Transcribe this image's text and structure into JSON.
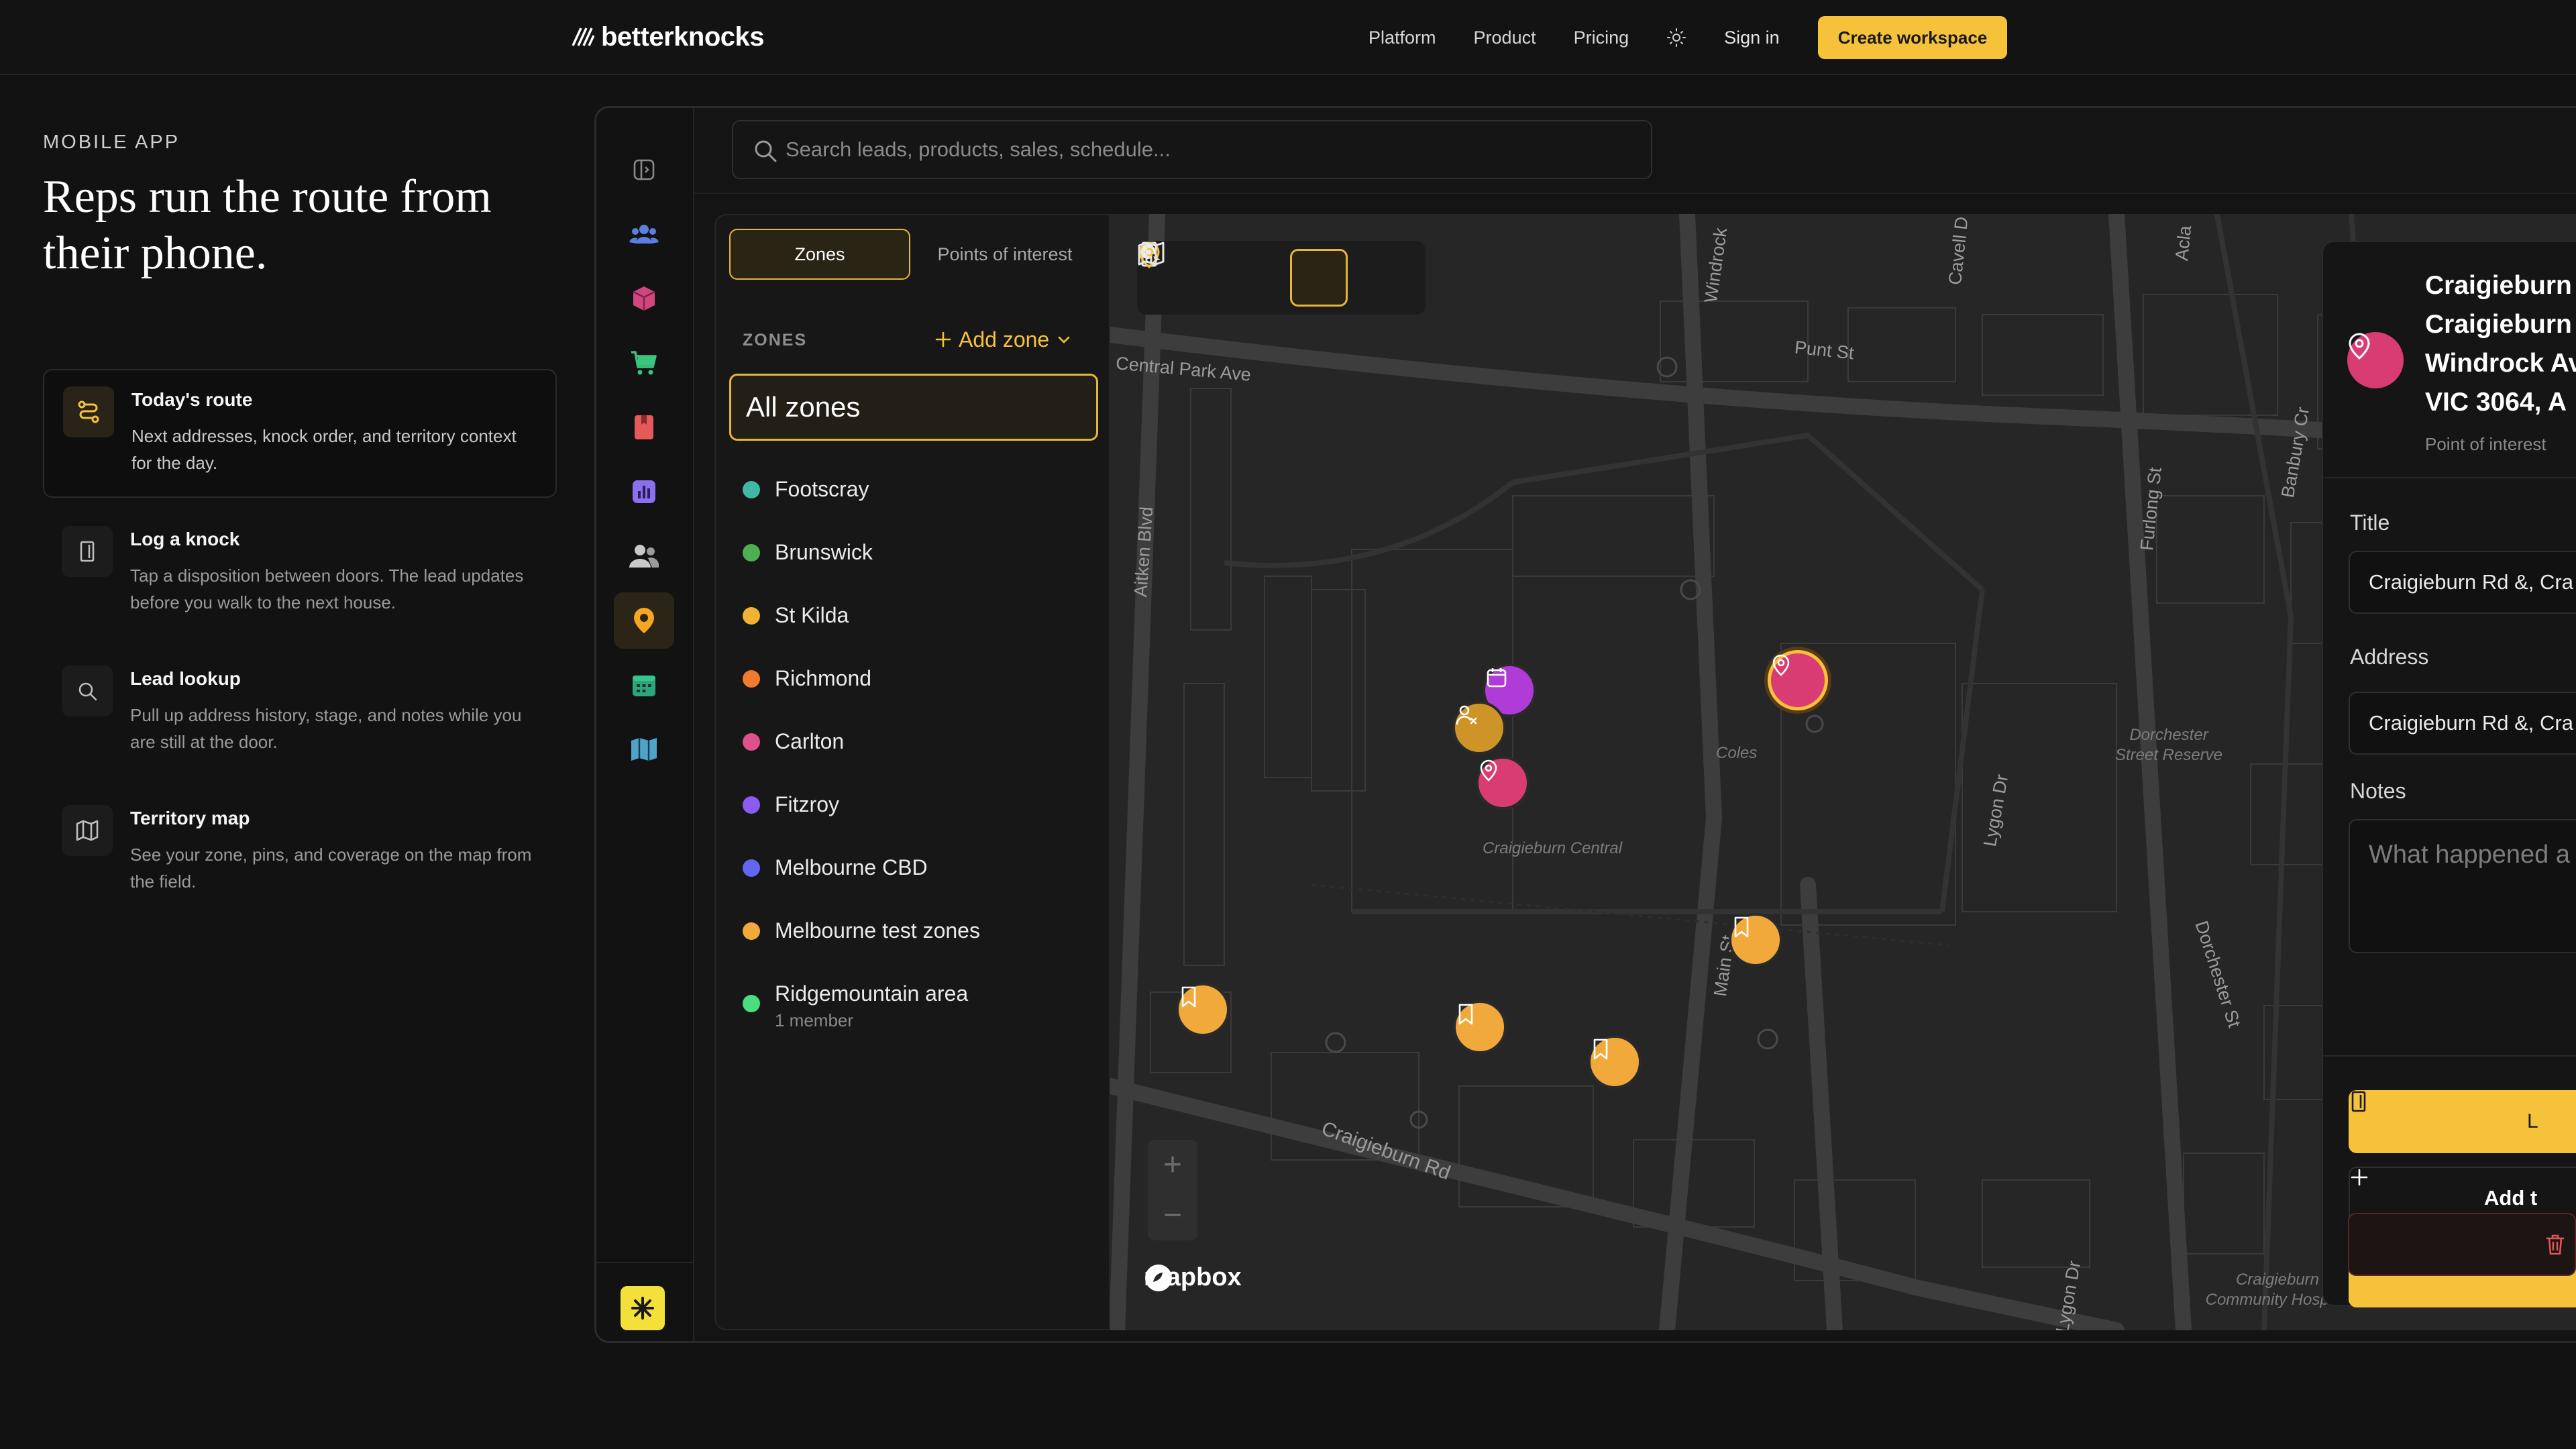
{
  "nav": {
    "brand": "betterknocks",
    "links": [
      "Platform",
      "Product",
      "Pricing"
    ],
    "signin": "Sign in",
    "cta": "Create workspace"
  },
  "hero": {
    "eyebrow": "MOBILE APP",
    "headline": "Reps run the route from their phone."
  },
  "features": [
    {
      "title": "Today's route",
      "desc": "Next addresses, knock order, and territory context for the day.",
      "icon": "route-icon"
    },
    {
      "title": "Log a knock",
      "desc": "Tap a disposition between doors. The lead updates before you walk to the next house.",
      "icon": "door-icon"
    },
    {
      "title": "Lead lookup",
      "desc": "Pull up address history, stage, and notes while you are still at the door.",
      "icon": "search-icon"
    },
    {
      "title": "Territory map",
      "desc": "See your zone, pins, and coverage on the map from the field.",
      "icon": "map-icon"
    }
  ],
  "app": {
    "search_placeholder": "Search leads, products, sales, schedule...",
    "tabs": [
      "Zones",
      "Points of interest"
    ],
    "zones_label": "ZONES",
    "add_zone": "Add zone",
    "all_zones": "All zones",
    "zones": [
      {
        "name": "Footscray",
        "color": "#3fb8a6"
      },
      {
        "name": "Brunswick",
        "color": "#4caf50"
      },
      {
        "name": "St Kilda",
        "color": "#f2b233"
      },
      {
        "name": "Richmond",
        "color": "#f07a2e"
      },
      {
        "name": "Carlton",
        "color": "#e0508a"
      },
      {
        "name": "Fitzroy",
        "color": "#8a5cf0"
      },
      {
        "name": "Melbourne CBD",
        "color": "#6366f1"
      },
      {
        "name": "Melbourne test zones",
        "color": "#f2a93b"
      },
      {
        "name": "Ridgemountain area",
        "color": "#4ade80",
        "sub": "1 member"
      }
    ]
  },
  "map": {
    "streets": [
      "Central Park Ave",
      "Aitken Blvd",
      "Windrock",
      "Cavell D",
      "Acla",
      "Punt St",
      "Furlong St",
      "Banbury Cr",
      "Lygon Dr",
      "Main St",
      "Craigieburn Rd",
      "Dorchester St",
      "Lygon Dr"
    ],
    "places": [
      "Coles",
      "Craigieburn Central",
      "Dorchester Street Reserve",
      "Craigieburn Community Hospital"
    ],
    "attribution": "mapbox"
  },
  "detail": {
    "title_lines": [
      "Craigieburn",
      "Craigieburn",
      "Windrock Av",
      "VIC 3064, A"
    ],
    "type": "Point of interest",
    "title_label": "Title",
    "title_value": "Craigieburn Rd &, Cra",
    "address_label": "Address",
    "address_value": "Craigieburn Rd &, Cra",
    "notes_label": "Notes",
    "notes_placeholder": "What happened a",
    "primary_btn": "L",
    "add_btn": "Add t"
  }
}
